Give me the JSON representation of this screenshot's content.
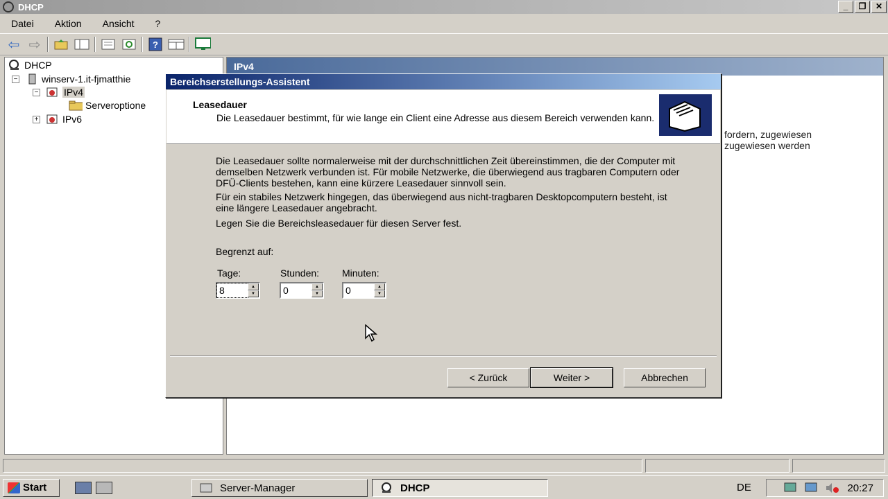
{
  "window": {
    "title": "DHCP"
  },
  "menu": [
    "Datei",
    "Aktion",
    "Ansicht",
    "?"
  ],
  "tree": {
    "root": "DHCP",
    "server": "winserv-1.it-fjmatthie",
    "ipv4": "IPv4",
    "serveroptions": "Serveroptione",
    "ipv6": "IPv6"
  },
  "right_pane": {
    "header": "IPv4",
    "line1": "fordern, zugewiesen",
    "line2": "zugewiesen werden"
  },
  "dialog": {
    "title": "Bereichserstellungs-Assistent",
    "heading": "Leasedauer",
    "subheading": "Die Leasedauer bestimmt, für wie lange ein Client eine Adresse aus diesem Bereich verwenden kann.",
    "para1": "Die Leasedauer sollte normalerweise mit der durchschnittlichen Zeit übereinstimmen, die der Computer mit demselben Netzwerk verbunden ist. Für mobile Netzwerke, die überwiegend aus tragbaren Computern oder DFÜ-Clients bestehen, kann eine kürzere Leasedauer sinnvoll sein.",
    "para2": "Für ein stabiles Netzwerk hingegen, das überwiegend aus nicht-tragbaren Desktopcomputern besteht, ist eine längere Leasedauer angebracht.",
    "para3": "Legen Sie die Bereichsleasedauer für diesen Server fest.",
    "limit_label": "Begrenzt auf:",
    "days_label": "Tage:",
    "days_value": "8",
    "hours_label": "Stunden:",
    "hours_value": "0",
    "minutes_label": "Minuten:",
    "minutes_value": "0",
    "back_label": "< Zurück",
    "next_label": "Weiter >",
    "cancel_label": "Abbrechen"
  },
  "taskbar": {
    "start": "Start",
    "task1": "Server-Manager",
    "task2": "DHCP",
    "lang": "DE",
    "clock": "20:27"
  }
}
